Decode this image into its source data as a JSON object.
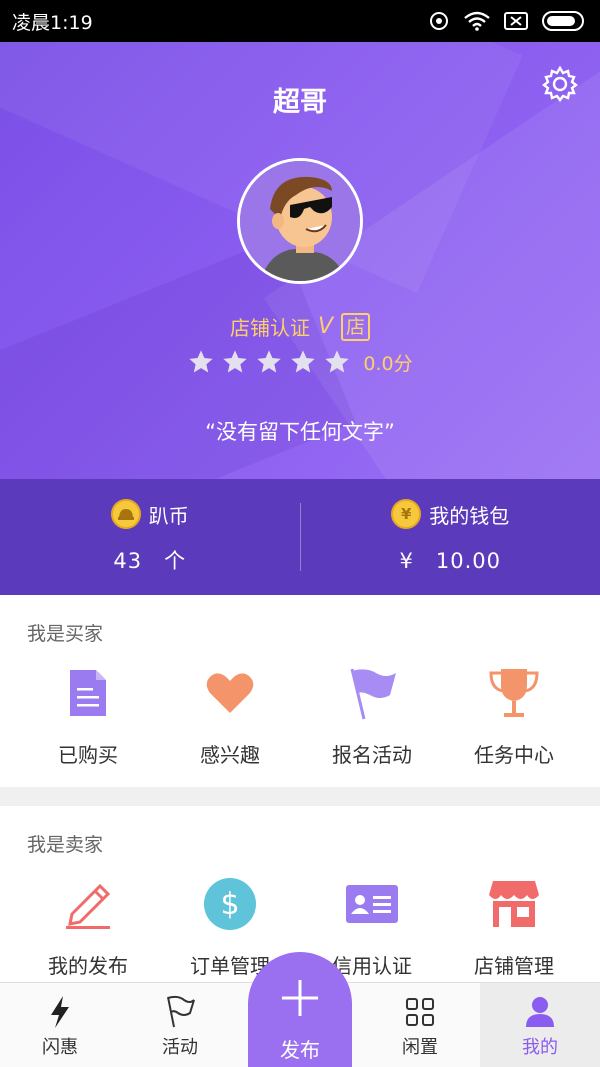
{
  "status_bar": {
    "time": "凌晨1:19"
  },
  "profile": {
    "username": "超哥",
    "cert_label": "店铺认证",
    "cert_mark": "V",
    "shop_badge": "店",
    "rating_stars": 5,
    "rating_filled": 0,
    "score": "0.0分",
    "motto": "“没有留下任何文字”"
  },
  "stats": {
    "coin_label": "趴币",
    "coin_value": "43　个",
    "wallet_label": "我的钱包",
    "wallet_symbol": "¥",
    "wallet_value": "¥　10.00"
  },
  "buyer": {
    "title": "我是买家",
    "items": [
      {
        "label": "已购买",
        "icon": "document-icon",
        "color": "#9b7cf0"
      },
      {
        "label": "感兴趣",
        "icon": "heart-icon",
        "color": "#f4946b"
      },
      {
        "label": "报名活动",
        "icon": "flag-icon",
        "color": "#a68cf3"
      },
      {
        "label": "任务中心",
        "icon": "trophy-icon",
        "color": "#f4946b"
      }
    ]
  },
  "seller": {
    "title": "我是卖家",
    "items": [
      {
        "label": "我的发布",
        "icon": "pencil-icon",
        "color": "#f26b6b"
      },
      {
        "label": "订单管理",
        "icon": "dollar-icon",
        "color": "#5fc3d9"
      },
      {
        "label": "信用认证",
        "icon": "id-card-icon",
        "color": "#9b7cf0"
      },
      {
        "label": "店铺管理",
        "icon": "store-icon",
        "color": "#f26b6b"
      }
    ]
  },
  "tabbar": {
    "items": [
      {
        "label": "闪惠",
        "icon": "lightning-icon"
      },
      {
        "label": "活动",
        "icon": "flag-outline-icon"
      },
      {
        "label": "发布",
        "icon": "plus-icon"
      },
      {
        "label": "闲置",
        "icon": "grid-icon"
      },
      {
        "label": "我的",
        "icon": "person-icon"
      }
    ],
    "active": "我的"
  },
  "colors": {
    "header": "#8a5cf0",
    "stats_bar": "#5b3bbb",
    "accent_gold": "#ffcf6a",
    "active_tab": "#8a5cf0"
  }
}
